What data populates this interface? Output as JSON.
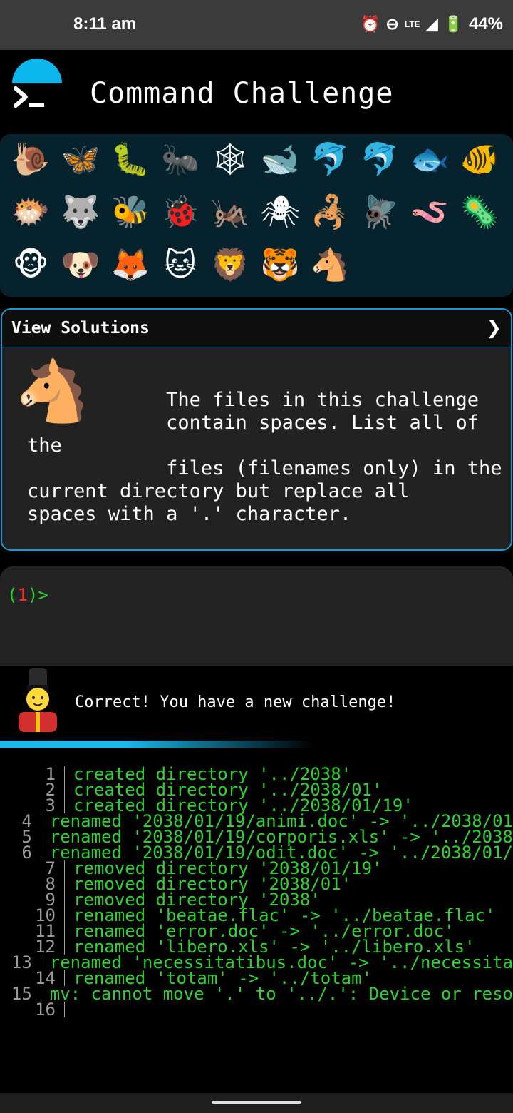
{
  "status": {
    "time": "8:11 am",
    "battery": "44%",
    "network": "LTE"
  },
  "header": {
    "title": "Command Challenge"
  },
  "animals": {
    "row1": [
      "🐌",
      "🦋",
      "🐛",
      "🐜",
      "🕸",
      "🐋",
      "🐬",
      "🐬",
      "🐟",
      "🐠"
    ],
    "row2": [
      "🐡",
      "🐺",
      "🐝",
      "🐞",
      "🦗",
      "🕷",
      "🦂",
      "🪰",
      "🪱",
      "🦠"
    ],
    "row3": [
      "🐵",
      "🐶",
      "🦊",
      "🐱",
      "🦁",
      "🐯",
      "🐴"
    ]
  },
  "solutions": {
    "label": "View Solutions",
    "chevron": "❯",
    "horse": "🐴",
    "description": "            The files in this challenge\n            contain spaces. List all of the\n            files (filenames only) in the\ncurrent directory but replace all\nspaces with a '.' character."
  },
  "terminal": {
    "prompt_open": "(",
    "prompt_num": "1",
    "prompt_close": ")>"
  },
  "feedback": {
    "message": "Correct! You have a new challenge!"
  },
  "output": {
    "lines": [
      {
        "n": "1",
        "t": "created directory '../2038'"
      },
      {
        "n": "2",
        "t": "created directory '../2038/01'"
      },
      {
        "n": "3",
        "t": "created directory '../2038/01/19'"
      },
      {
        "n": "4",
        "t": "renamed '2038/01/19/animi.doc' -> '../2038/01"
      },
      {
        "n": "5",
        "t": "renamed '2038/01/19/corporis.xls' -> '../2038"
      },
      {
        "n": "6",
        "t": "renamed '2038/01/19/odit.doc' -> '../2038/01/"
      },
      {
        "n": "7",
        "t": "removed directory '2038/01/19'"
      },
      {
        "n": "8",
        "t": "removed directory '2038/01'"
      },
      {
        "n": "9",
        "t": "removed directory '2038'"
      },
      {
        "n": "10",
        "t": "renamed 'beatae.flac' -> '../beatae.flac'"
      },
      {
        "n": "11",
        "t": "renamed 'error.doc' -> '../error.doc'"
      },
      {
        "n": "12",
        "t": "renamed 'libero.xls' -> '../libero.xls'"
      },
      {
        "n": "13",
        "t": "renamed 'necessitatibus.doc' -> '../necessita"
      },
      {
        "n": "14",
        "t": "renamed 'totam' -> '../totam'"
      },
      {
        "n": "15",
        "t": "mv: cannot move '.' to '../.': Device or reso"
      },
      {
        "n": "16",
        "t": ""
      }
    ]
  },
  "colors": {
    "accent": "#0bb7ec",
    "terminal_green": "#2ed22e",
    "prompt_red": "#ff2b2b"
  }
}
